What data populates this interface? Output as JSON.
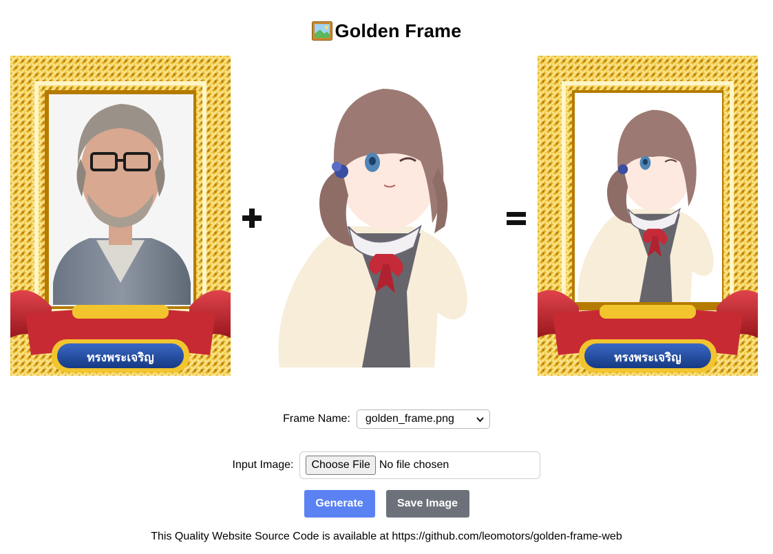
{
  "title": "Golden Frame",
  "title_icon": "framed-picture-icon",
  "images": {
    "left": {
      "banner_text": "ทรงพระเจริญ"
    },
    "middle": {},
    "right": {
      "banner_text": "ทรงพระเจริญ"
    }
  },
  "operators": {
    "plus": "plus-icon",
    "equals": "equals-icon"
  },
  "form": {
    "frame_name_label": "Frame Name:",
    "frame_name_value": "golden_frame.png",
    "input_image_label": "Input Image:",
    "choose_file_label": "Choose File",
    "file_status": "No file chosen"
  },
  "buttons": {
    "generate": "Generate",
    "save": "Save Image"
  },
  "footer": "This Quality Website Source Code is available at https://github.com/leomotors/golden-frame-web",
  "colors": {
    "gold": "#e9b300",
    "ribbon_red": "#c0252e",
    "banner_blue": "#1f4a9e",
    "generate_button": "#5b82f3",
    "save_button": "#6d727a"
  }
}
